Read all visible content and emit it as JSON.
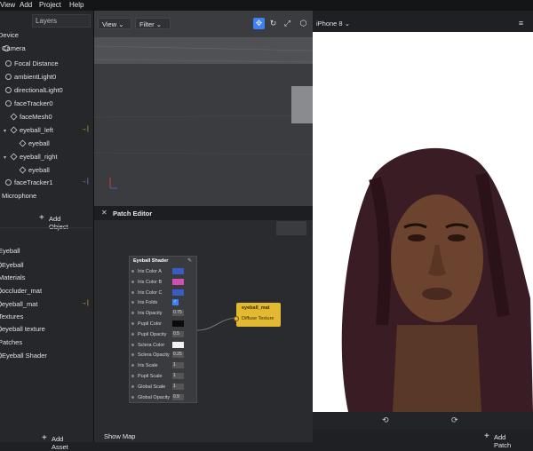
{
  "menu": [
    "View",
    "Add",
    "Project",
    "Help"
  ],
  "layers_tab": "Layers",
  "scene": [
    {
      "label": "Device",
      "indent": 0,
      "icon": "none"
    },
    {
      "label": "Camera",
      "indent": 1,
      "icon": "camera"
    },
    {
      "label": "Focal Distance",
      "indent": 2,
      "icon": "focal"
    },
    {
      "label": "ambientLight0",
      "indent": 2,
      "icon": "light"
    },
    {
      "label": "directionalLight0",
      "indent": 2,
      "icon": "light"
    },
    {
      "label": "faceTracker0",
      "indent": 2,
      "icon": "tracker"
    },
    {
      "label": "faceMesh0",
      "indent": 3,
      "icon": "mesh"
    },
    {
      "label": "eyeball_left",
      "indent": 3,
      "icon": "tri",
      "action": "→|"
    },
    {
      "label": "eyeball",
      "indent": 4,
      "icon": "mesh"
    },
    {
      "label": "eyeball_right",
      "indent": 3,
      "icon": "tri"
    },
    {
      "label": "eyeball",
      "indent": 4,
      "icon": "mesh"
    },
    {
      "label": "faceTracker1",
      "indent": 2,
      "icon": "tracker",
      "action": "→|"
    },
    {
      "label": "Microphone",
      "indent": 1,
      "icon": "none"
    }
  ],
  "add_object": "Add Object",
  "assets": [
    {
      "label": "Eyeball",
      "type": "section"
    },
    {
      "label": "Eyeball",
      "type": "item"
    },
    {
      "label": "Materials",
      "type": "section"
    },
    {
      "label": "occluder_mat",
      "type": "item"
    },
    {
      "label": "eyeball_mat",
      "type": "item",
      "action": "→|"
    },
    {
      "label": "Textures",
      "type": "section"
    },
    {
      "label": "eyeball texture",
      "type": "item"
    },
    {
      "label": "Patches",
      "type": "section"
    },
    {
      "label": "Eyeball Shader",
      "type": "item"
    }
  ],
  "add_asset": "Add Asset",
  "toolbar": {
    "view": "View",
    "filter": "Filter",
    "device": "iPhone 8"
  },
  "patch_editor": {
    "title": "Patch Editor",
    "show_map": "Show Map",
    "add_patch": "Add Patch"
  },
  "shader": {
    "title": "Eyeball Shader",
    "params": [
      {
        "name": "Iris Color A",
        "value": "",
        "swatch": "#3a5bc4"
      },
      {
        "name": "Iris Color B",
        "value": "",
        "swatch": "#d04fb0"
      },
      {
        "name": "Iris Color C",
        "value": "",
        "swatch": "#3a5bc4"
      },
      {
        "name": "Iris Folds",
        "value": "",
        "check": true
      },
      {
        "name": "Iris Opacity",
        "value": "0.75"
      },
      {
        "name": "Pupil Color",
        "value": "",
        "swatch": "#0b0b0b"
      },
      {
        "name": "Pupil Opacity",
        "value": "0.5"
      },
      {
        "name": "Sclera Color",
        "value": "",
        "swatch": "#f2f2f2"
      },
      {
        "name": "Sclera Opacity",
        "value": "0.25"
      },
      {
        "name": "Iris Scale",
        "value": "1"
      },
      {
        "name": "Pupil Scale",
        "value": "1"
      },
      {
        "name": "Global Scale",
        "value": "1"
      },
      {
        "name": "Global Opacity",
        "value": "0.9"
      }
    ]
  },
  "material_node": {
    "title": "eyeball_mat",
    "port": "Diffuse Texture"
  },
  "colors": {
    "accent": "#3b82f6",
    "material": "#e3b931"
  }
}
